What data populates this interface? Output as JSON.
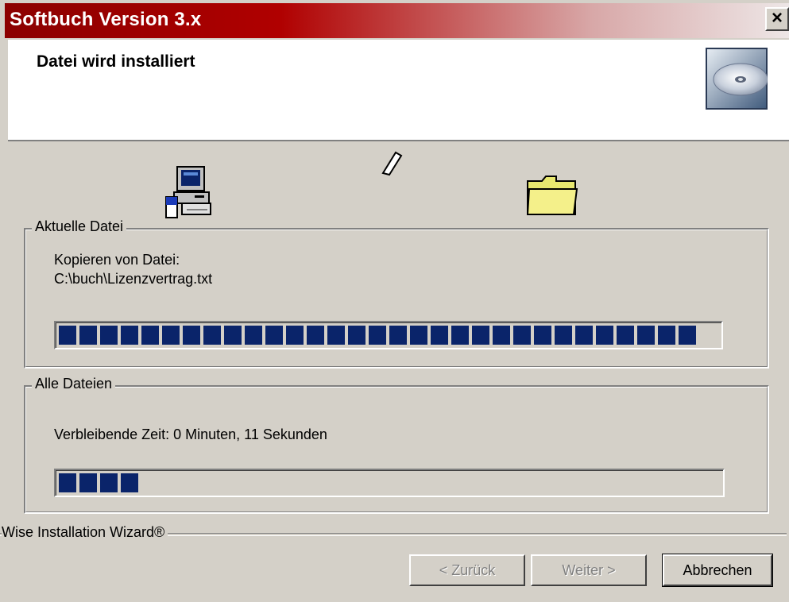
{
  "window": {
    "title": "Softbuch Version 3.x",
    "close_label": "×"
  },
  "header": {
    "title": "Datei wird installiert",
    "icon": "cd-icon"
  },
  "animation": {
    "icons": [
      "computer-icon",
      "paper-icon",
      "folder-icon"
    ]
  },
  "current_file": {
    "legend": "Aktuelle Datei",
    "line1": "Kopieren von Datei:",
    "line2": "C:\\buch\\Lizenzvertrag.txt",
    "progress": 1.0
  },
  "all_files": {
    "legend": "Alle Dateien",
    "remaining": "Verbleibende Zeit: 0 Minuten, 11 Sekunden",
    "progress": 0.12
  },
  "footer": {
    "brand": "Wise Installation Wizard®",
    "back_label": "< Zurück",
    "next_label": "Weiter >",
    "cancel_label": "Abbrechen"
  },
  "colors": {
    "titlebar_start": "#8b0000",
    "progress_block": "#0a246a",
    "face": "#d4d0c8"
  }
}
